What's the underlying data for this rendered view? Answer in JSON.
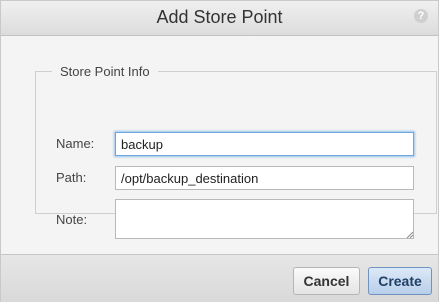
{
  "dialog": {
    "title": "Add Store Point",
    "help_icon": "?"
  },
  "form": {
    "legend": "Store Point Info",
    "name_label": "Name:",
    "name_value": "backup",
    "path_label": "Path:",
    "path_value": "/opt/backup_destination",
    "note_label": "Note:",
    "note_value": ""
  },
  "buttons": {
    "cancel": "Cancel",
    "create": "Create"
  },
  "colors": {
    "focus_ring": "#6fa6dc",
    "primary_button": "#b8cfea"
  },
  "icons": {
    "help": "help-icon",
    "resize": "resize-grip-icon"
  }
}
